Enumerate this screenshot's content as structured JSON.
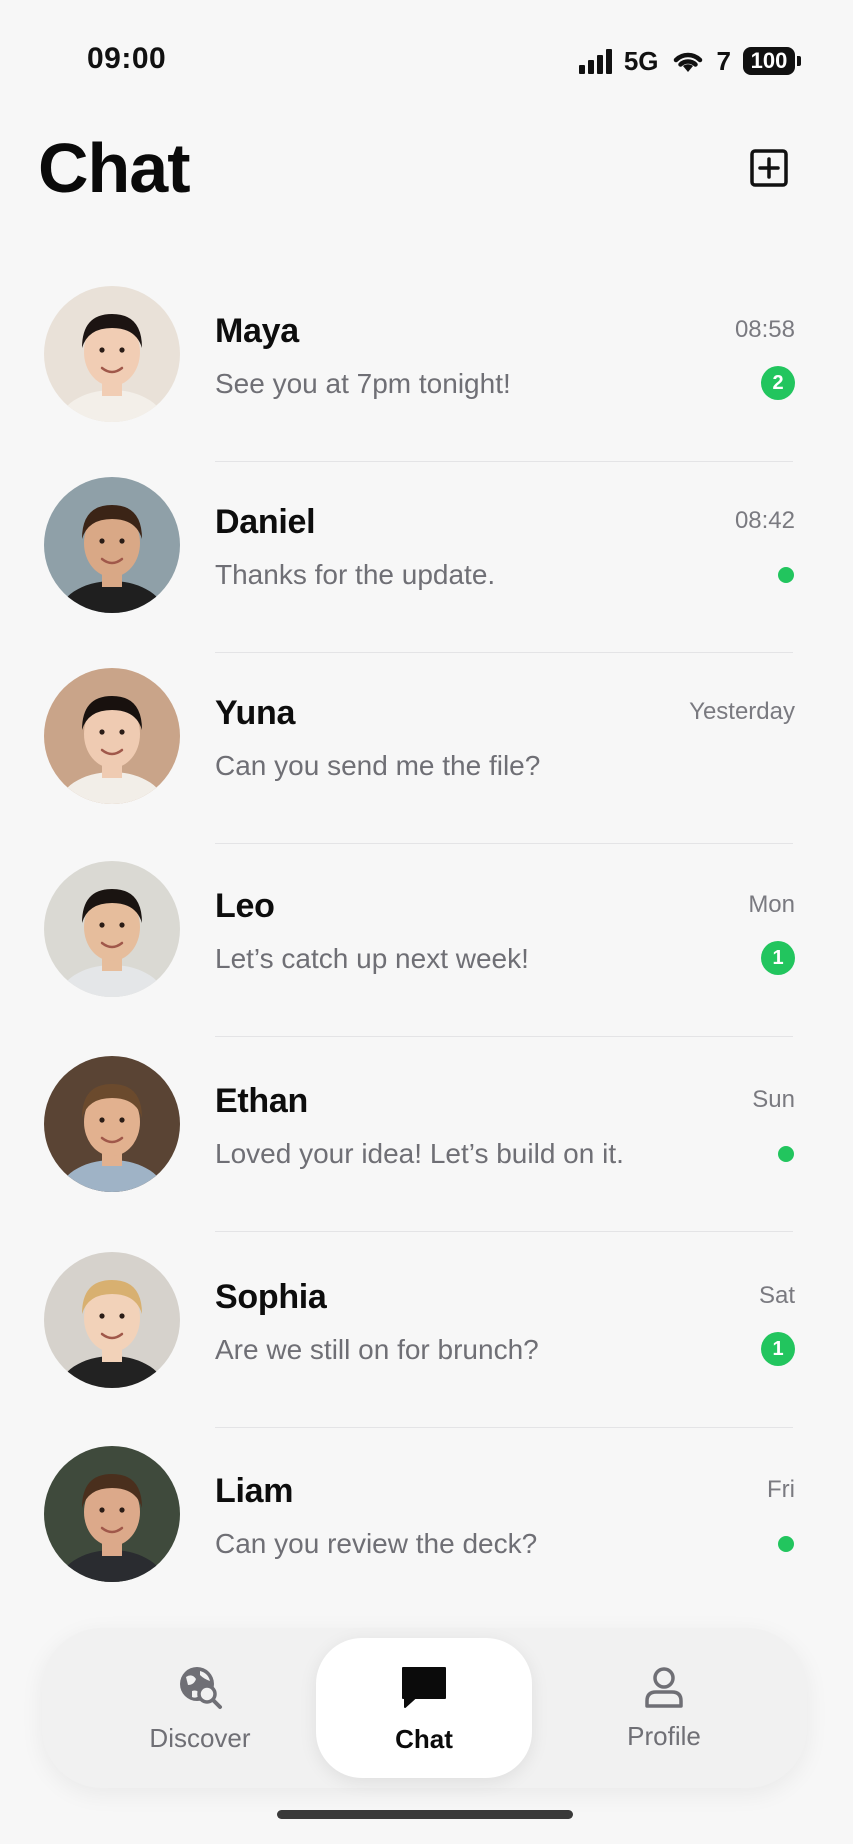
{
  "status_bar": {
    "time": "09:00",
    "network": "5G",
    "wifi_label": "7",
    "battery": "100"
  },
  "header": {
    "title": "Chat",
    "new_chat_icon": "plus-square-icon"
  },
  "chats": [
    {
      "name": "Maya",
      "preview": "See you at 7pm tonight!",
      "time": "08:58",
      "unread": "2",
      "online": false,
      "avatar_bg": "#e9e1d8",
      "hair": "#1c1412",
      "skin": "#f1cdb4",
      "shirt": "#f3efe9"
    },
    {
      "name": "Daniel",
      "preview": "Thanks for the update.",
      "time": "08:42",
      "unread": "",
      "online": true,
      "avatar_bg": "#8fa0a8",
      "hair": "#3b2416",
      "skin": "#d9a886",
      "shirt": "#1f1f1f"
    },
    {
      "name": "Yuna",
      "preview": "Can you send me the file?",
      "time": "Yesterday",
      "unread": "",
      "online": false,
      "avatar_bg": "#c9a489",
      "hair": "#18110e",
      "skin": "#efcbb2",
      "shirt": "#f2eee8"
    },
    {
      "name": "Leo",
      "preview": "Let’s catch up next week!",
      "time": "Mon",
      "unread": "1",
      "online": false,
      "avatar_bg": "#dad9d3",
      "hair": "#1a1411",
      "skin": "#e6bd9c",
      "shirt": "#e4e6e8"
    },
    {
      "name": "Ethan",
      "preview": "Loved your idea! Let’s build on it.",
      "time": "Sun",
      "unread": "",
      "online": true,
      "avatar_bg": "#5a4434",
      "hair": "#6b4a2d",
      "skin": "#e2b18f",
      "shirt": "#9fb3c6"
    },
    {
      "name": "Sophia",
      "preview": "Are we still on for brunch?",
      "time": "Sat",
      "unread": "1",
      "online": false,
      "avatar_bg": "#d6d2cc",
      "hair": "#d8b070",
      "skin": "#f2d2b9",
      "shirt": "#222222"
    },
    {
      "name": "Liam",
      "preview": "Can you review the deck?",
      "time": "Fri",
      "unread": "",
      "online": true,
      "avatar_bg": "#3f4a3c",
      "hair": "#4a2f1d",
      "skin": "#dca98a",
      "shirt": "#2a2c30"
    }
  ],
  "tabs": [
    {
      "label": "Discover",
      "icon": "globe-search-icon",
      "active": false
    },
    {
      "label": "Chat",
      "icon": "chat-bubble-icon",
      "active": true
    },
    {
      "label": "Profile",
      "icon": "person-icon",
      "active": false
    }
  ],
  "colors": {
    "accent": "#22c55e",
    "background": "#f7f7f7",
    "text_primary": "#0d0d0d",
    "text_secondary": "#6f6f75"
  }
}
